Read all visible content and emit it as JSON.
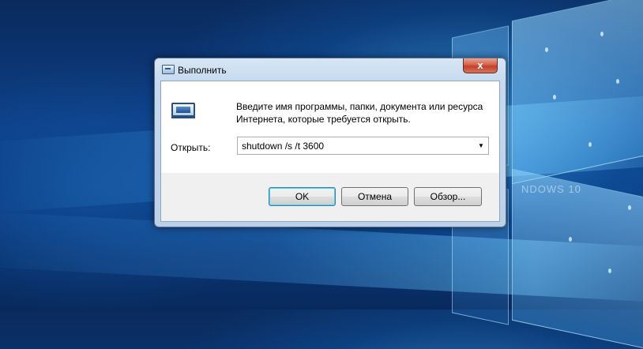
{
  "desktop": {
    "watermark": "NDOWS 10"
  },
  "dialog": {
    "title": "Выполнить",
    "close_label": "x",
    "icon": "run-program-icon",
    "prompt_line1": "Введите имя программы, папки, документа или ресурса",
    "prompt_line2": "Интернета, которые требуется открыть.",
    "open_label": "Открыть:",
    "open_value": "shutdown /s /t 3600",
    "buttons": {
      "ok": "OK",
      "cancel": "Отмена",
      "browse": "Обзор..."
    },
    "colors": {
      "close_button": "#c2402a",
      "default_button_border": "#3c7fb1"
    }
  }
}
